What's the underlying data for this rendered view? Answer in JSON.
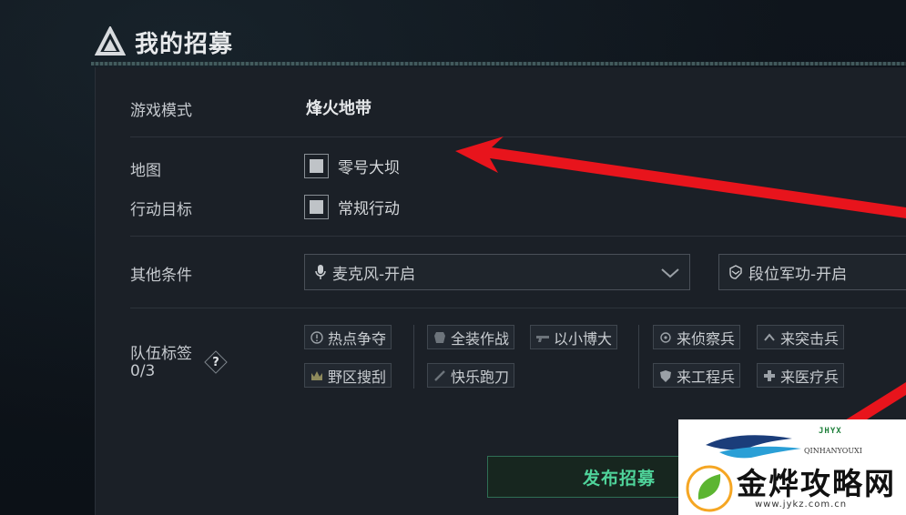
{
  "header": {
    "title": "我的招募"
  },
  "form": {
    "mode": {
      "label": "游戏模式",
      "value": "烽火地带"
    },
    "map": {
      "label": "地图",
      "option": "零号大坝"
    },
    "objective": {
      "label": "行动目标",
      "option": "常规行动"
    },
    "conditions": {
      "label": "其他条件",
      "mic_select": "麦克风-开启",
      "rank_select": "段位军功-开启"
    },
    "tags": {
      "label": "队伍标签",
      "count": "0/3",
      "help": "?",
      "items": [
        "热点争夺",
        "野区搜刮",
        "全装作战",
        "快乐跑刀",
        "以小博大",
        "来侦察兵",
        "来工程兵",
        "来突击兵",
        "来医疗兵"
      ]
    },
    "publish_label": "发布招募"
  },
  "watermark": {
    "brand_code": "JHYX",
    "pinyin": "QINHANYOUXI",
    "name": "金烨攻略网",
    "url": "www.jykz.com.cn"
  },
  "colors": {
    "accent": "#4fd39a",
    "annotation_arrow": "#e8141c"
  },
  "icons": [
    "logo-icon",
    "chevron-down-icon",
    "microphone-icon",
    "rank-icon",
    "help-icon"
  ]
}
